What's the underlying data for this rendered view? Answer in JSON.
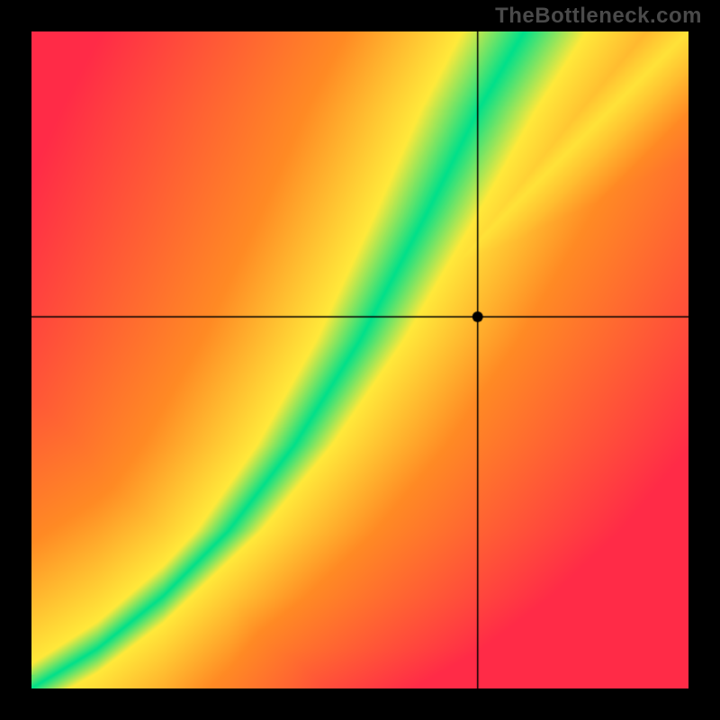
{
  "watermark": "TheBottleneck.com",
  "colors": {
    "red": "#ff2b47",
    "orange": "#ff8a24",
    "yellow": "#ffe93a",
    "green": "#00e08a",
    "crosshair": "#000000",
    "marker": "#000000",
    "border": "#000000"
  },
  "chart_data": {
    "type": "heatmap",
    "title": "",
    "xlabel": "",
    "ylabel": "",
    "xlim": [
      0,
      1
    ],
    "ylim": [
      0,
      1
    ],
    "description": "Bottleneck compatibility heatmap. Color indicates match quality (green = optimal, red = severe bottleneck). A diagonal green ridge curves from the bottom-left corner upward, steepening through the middle, representing balanced component pairings. Areas far from the ridge fade through yellow/orange to red.",
    "marker": {
      "x": 0.68,
      "y": 0.565,
      "note": "Crosshair intersection point slightly right of the green optimal band, in yellow/orange region."
    },
    "ridge_control_points": [
      {
        "x": 0.0,
        "y": 0.0
      },
      {
        "x": 0.1,
        "y": 0.06
      },
      {
        "x": 0.2,
        "y": 0.14
      },
      {
        "x": 0.3,
        "y": 0.24
      },
      {
        "x": 0.4,
        "y": 0.37
      },
      {
        "x": 0.5,
        "y": 0.53
      },
      {
        "x": 0.6,
        "y": 0.72
      },
      {
        "x": 0.68,
        "y": 0.88
      },
      {
        "x": 0.75,
        "y": 1.0
      }
    ],
    "secondary_diagonal": {
      "start": {
        "x": 0.0,
        "y": 0.0
      },
      "end": {
        "x": 1.0,
        "y": 1.0
      },
      "note": "faint yellow straight diagonal toward upper-right"
    },
    "legend": null
  }
}
